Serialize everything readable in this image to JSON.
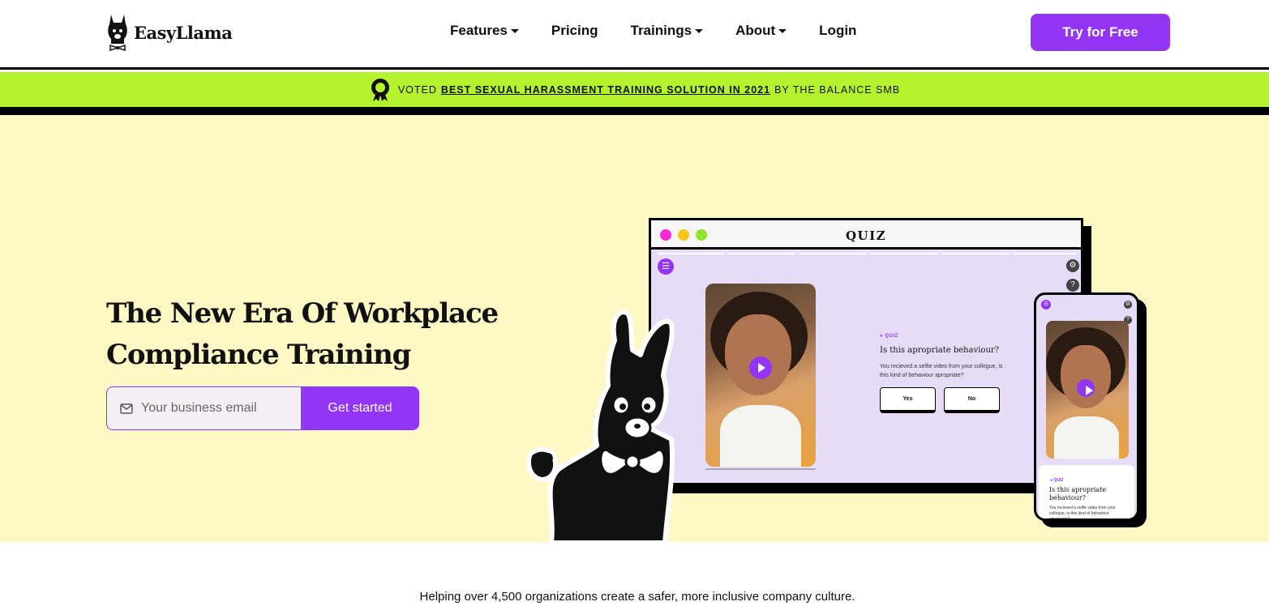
{
  "brand": {
    "name": "EasyLlama",
    "accent": "#9335f5",
    "banner_color": "#b4f22e",
    "hero_bg": "#fef8c4"
  },
  "nav": {
    "items": [
      {
        "label": "Features",
        "has_dropdown": true
      },
      {
        "label": "Pricing",
        "has_dropdown": false
      },
      {
        "label": "Trainings",
        "has_dropdown": true
      },
      {
        "label": "About",
        "has_dropdown": true
      },
      {
        "label": "Login",
        "has_dropdown": false
      }
    ],
    "cta_label": "Try for Free"
  },
  "banner": {
    "icon": "award-medal-icon",
    "prefix": "VOTED",
    "link_text": "BEST SEXUAL HARASSMENT TRAINING SOLUTION IN 2021",
    "suffix": "BY THE BALANCE SMB"
  },
  "hero": {
    "headline_line1": "The New Era Of Workplace",
    "headline_line2": "Compliance Training",
    "email_placeholder": "Your business email",
    "email_icon": "envelope-icon",
    "submit_label": "Get started"
  },
  "quiz_window": {
    "title": "QUIZ",
    "window_dots": [
      "#f72bd3",
      "#f5c519",
      "#8ee62b"
    ],
    "tag": "QUIZ",
    "question": "Is this apropriate behaviour?",
    "description": "You recieved a selfie video from your collegue, is this kind of behaviour apropriate?",
    "answers": [
      "Yes",
      "No"
    ]
  },
  "phone": {
    "tag": "QUIZ",
    "question": "Is this apropriate behaviour?",
    "description": "You recieved a selfie video from your collegue, is this kind of behaviour apropriate?"
  },
  "tagline": "Helping over 4,500 organizations create a safer, more inclusive company culture."
}
